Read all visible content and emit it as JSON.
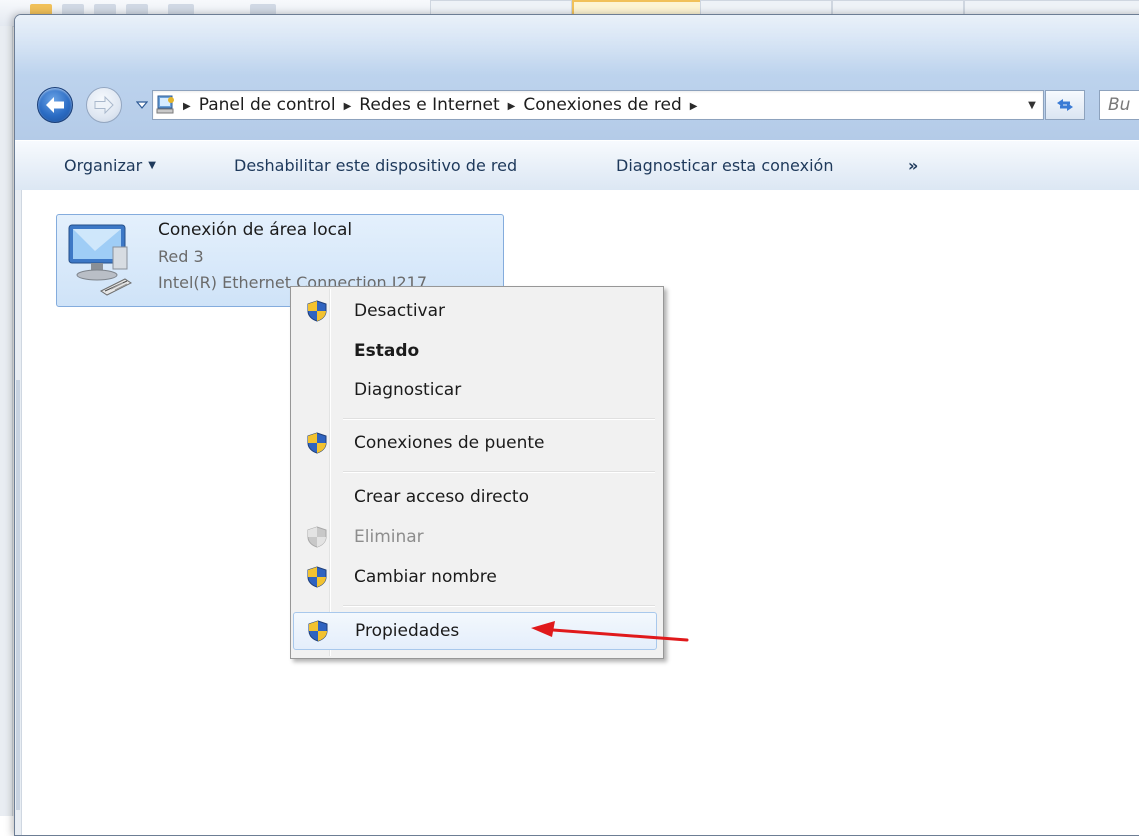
{
  "address": {
    "breadcrumbs": [
      "Panel de control",
      "Redes e Internet",
      "Conexiones de red"
    ],
    "search_placeholder": "Bu"
  },
  "command_bar": {
    "organize_label": "Organizar",
    "disable_label": "Deshabilitar este dispositivo de red",
    "diagnose_label": "Diagnosticar esta conexión",
    "more_label": "»"
  },
  "connection": {
    "name": "Conexión de área local",
    "network": "Red 3",
    "device": "Intel(R) Ethernet Connection I217"
  },
  "context_menu": {
    "items": [
      {
        "label": "Desactivar",
        "shield": true,
        "bold": false,
        "disabled": false
      },
      {
        "label": "Estado",
        "shield": false,
        "bold": true,
        "disabled": false
      },
      {
        "label": "Diagnosticar",
        "shield": false,
        "bold": false,
        "disabled": false
      },
      {
        "label": "Conexiones de puente",
        "shield": true,
        "bold": false,
        "disabled": false
      },
      {
        "label": "Crear acceso directo",
        "shield": false,
        "bold": false,
        "disabled": false
      },
      {
        "label": "Eliminar",
        "shield": true,
        "bold": false,
        "disabled": true
      },
      {
        "label": "Cambiar nombre",
        "shield": true,
        "bold": false,
        "disabled": false
      },
      {
        "label": "Propiedades",
        "shield": true,
        "bold": false,
        "disabled": false,
        "highlighted": true
      }
    ]
  },
  "icons": {
    "back": "back-arrow-icon",
    "forward": "forward-arrow-icon",
    "control_panel": "control-panel-icon",
    "refresh": "refresh-icon",
    "shield": "uac-shield-icon",
    "network_adapter": "network-adapter-icon"
  },
  "colors": {
    "titlebar": "#bed4ee",
    "command_text": "#1e395b",
    "selection_fill": "#cfe3f8",
    "selection_border": "#84acdd",
    "annotation_arrow": "#e0191b"
  }
}
